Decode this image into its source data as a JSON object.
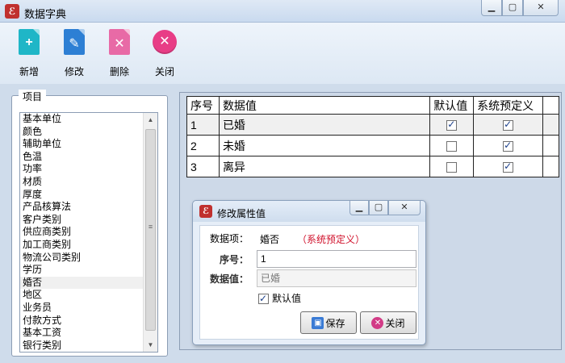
{
  "window": {
    "title": "数据字典",
    "app_icon": "app-logo-icon"
  },
  "toolbar": {
    "add": {
      "label": "新增",
      "icon": "add-document-icon",
      "color": "#1fb6c7"
    },
    "edit": {
      "label": "修改",
      "icon": "edit-document-icon",
      "color": "#2d7fd4"
    },
    "delete": {
      "label": "删除",
      "icon": "delete-document-icon",
      "color": "#e86aa6"
    },
    "close": {
      "label": "关闭",
      "icon": "close-circle-icon",
      "color": "#e83d86"
    }
  },
  "items_group": {
    "legend": "项目",
    "items": [
      "基本单位",
      "颜色",
      "辅助单位",
      "色温",
      "功率",
      "材质",
      "厚度",
      "产品核算法",
      "客户类别",
      "供应商类别",
      "加工商类别",
      "物流公司类别",
      "学历",
      "婚否",
      "地区",
      "业务员",
      "付款方式",
      "基本工资",
      "银行类别"
    ],
    "selected_index": 13
  },
  "grid": {
    "headers": {
      "seq": "序号",
      "value": "数据值",
      "default": "默认值",
      "system": "系统预定义"
    },
    "rows": [
      {
        "seq": "1",
        "value": "已婚",
        "default": true,
        "system": true
      },
      {
        "seq": "2",
        "value": "未婚",
        "default": false,
        "system": true
      },
      {
        "seq": "3",
        "value": "离异",
        "default": false,
        "system": true
      }
    ]
  },
  "dialog": {
    "title": "修改属性值",
    "item_label": "数据项：",
    "item_value": "婚否",
    "item_tag": "（系统预定义）",
    "seq_label": "序号：",
    "seq_value": "1",
    "data_label": "数据值：",
    "data_value": "已婚",
    "default_label": "默认值",
    "default_checked": true,
    "save_label": "保存",
    "close_label": "关闭"
  },
  "colors": {
    "tag_red": "#d0112b",
    "save_icon": "#3a7bd5",
    "close_icon": "#d23b86"
  }
}
